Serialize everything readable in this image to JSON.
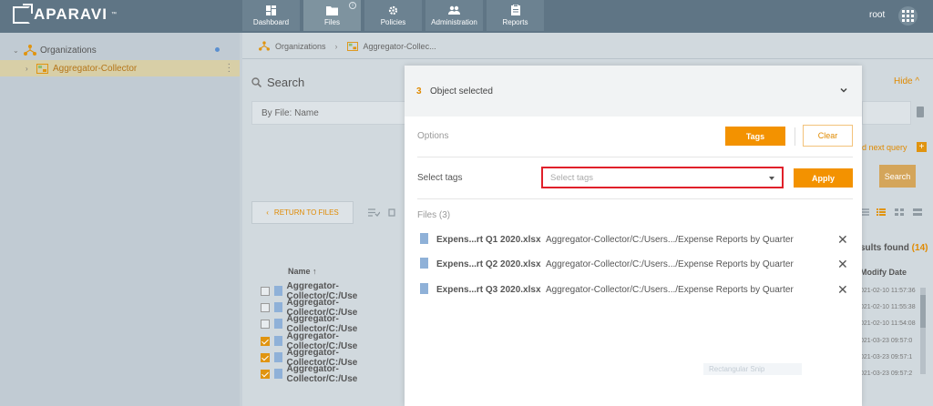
{
  "app": {
    "brand": "APARAVI",
    "brand_mark": "™"
  },
  "nav": [
    {
      "label": "Dashboard",
      "icon": "dashboard-icon"
    },
    {
      "label": "Files",
      "icon": "folder-icon",
      "active": true
    },
    {
      "label": "Policies",
      "icon": "gear-icon"
    },
    {
      "label": "Administration",
      "icon": "users-icon"
    },
    {
      "label": "Reports",
      "icon": "clipboard-icon"
    }
  ],
  "nav_info": "i",
  "user": {
    "name": "root"
  },
  "sidebar": {
    "items": [
      {
        "label": "Organizations",
        "caret": "⌄"
      },
      {
        "label": "Aggregator-Collector",
        "caret": "›"
      }
    ]
  },
  "breadcrumb": {
    "root": "Organizations",
    "separator": "›",
    "current": "Aggregator-Collec..."
  },
  "search": {
    "title": "Search",
    "hide_label": "Hide",
    "query_text": "By File: Name",
    "next_query": "d next query",
    "next_plus": "+",
    "button": "Search"
  },
  "toolbar": {
    "return_label": "RETURN TO FILES"
  },
  "results": {
    "prefix": "sults found",
    "count": "(14)"
  },
  "table": {
    "col_name": "Name",
    "col_modify": "Modify Date",
    "rows": [
      {
        "name": "Aggregator-Collector/C:/Use",
        "date": "021-02-10 11:57:36",
        "checked": false
      },
      {
        "name": "Aggregator-Collector/C:/Use",
        "date": "021-02-10 11:55:38",
        "checked": false
      },
      {
        "name": "Aggregator-Collector/C:/Use",
        "date": "021-02-10 11:54:08",
        "checked": false
      },
      {
        "name": "Aggregator-Collector/C:/Use",
        "date": "021-03-23 09:57:0",
        "checked": true
      },
      {
        "name": "Aggregator-Collector/C:/Use",
        "date": "021-03-23 09:57:1",
        "checked": true
      },
      {
        "name": "Aggregator-Collector/C:/Use",
        "date": "021-03-23 09:57:2",
        "checked": true
      }
    ]
  },
  "modal": {
    "selected_count": "3",
    "selected_label": "Object selected",
    "options_label": "Options",
    "tags_button": "Tags",
    "clear_button": "Clear",
    "select_tags_label": "Select tags",
    "select_tags_placeholder": "Select tags",
    "apply_button": "Apply",
    "files_label": "Files (3)",
    "remove_glyph": "✕",
    "files": [
      {
        "name": "Expens...rt Q1 2020.xlsx",
        "path": "Aggregator-Collector/C:/Users.../Expense Reports by Quarter"
      },
      {
        "name": "Expens...rt Q2 2020.xlsx",
        "path": "Aggregator-Collector/C:/Users.../Expense Reports by Quarter"
      },
      {
        "name": "Expens...rt Q3 2020.xlsx",
        "path": "Aggregator-Collector/C:/Users.../Expense Reports by Quarter"
      }
    ],
    "ghost_text": "Rectangular Snip"
  },
  "colors": {
    "accent": "#f39200",
    "topbar": "#5f7585",
    "highlight": "#e0202a"
  }
}
